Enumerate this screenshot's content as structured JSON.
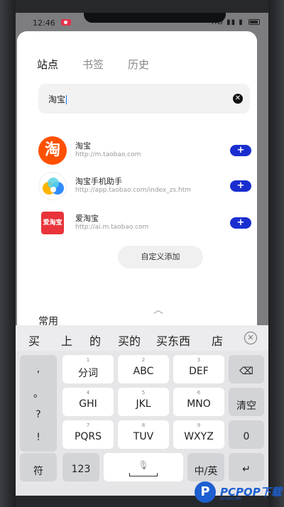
{
  "status_bar": {
    "time": "12:46",
    "right": "HD ▮▮ ▮"
  },
  "tabs": [
    {
      "label": "站点",
      "active": true
    },
    {
      "label": "书签",
      "active": false
    },
    {
      "label": "历史",
      "active": false
    }
  ],
  "search": {
    "value": "淘宝"
  },
  "sites": [
    {
      "name": "淘宝",
      "url": "http://m.taobao.com",
      "logo": "淘",
      "icon": "taobao-logo-icon"
    },
    {
      "name": "淘宝手机助手",
      "url": "http://app.taobao.com/index_zs.htm",
      "icon": "taobao-helper-logo-icon"
    },
    {
      "name": "爱淘宝",
      "url": "http://ai.m.taobao.com",
      "logo": "爱淘宝",
      "icon": "aitaobao-logo-icon"
    }
  ],
  "add_label": "+",
  "custom_add_label": "自定义添加",
  "section_title": "常用",
  "candidates": [
    "买",
    "上",
    "的",
    "买的",
    "买东西",
    "店"
  ],
  "keyboard": {
    "side": [
      ",",
      "。",
      "?",
      "!"
    ],
    "rows": [
      [
        {
          "num": "1",
          "lbl": "分词"
        },
        {
          "num": "2",
          "lbl": "ABC"
        },
        {
          "num": "3",
          "lbl": "DEF"
        }
      ],
      [
        {
          "num": "4",
          "lbl": "GHI"
        },
        {
          "num": "5",
          "lbl": "JKL"
        },
        {
          "num": "6",
          "lbl": "MNO"
        }
      ],
      [
        {
          "num": "7",
          "lbl": "PQRS"
        },
        {
          "num": "8",
          "lbl": "TUV"
        },
        {
          "num": "9",
          "lbl": "WXYZ"
        }
      ]
    ],
    "backspace": "⌫",
    "clear": "清空",
    "zero": "0",
    "symbol": "符",
    "num123": "123",
    "lang": "中/英",
    "enter": "↵"
  },
  "watermark": {
    "text": "PCPOP",
    "suffix": "下载",
    "sub": "PCPOP.COM"
  },
  "colors": {
    "accent": "#1a2ed0",
    "taobao": "#ff5000"
  }
}
